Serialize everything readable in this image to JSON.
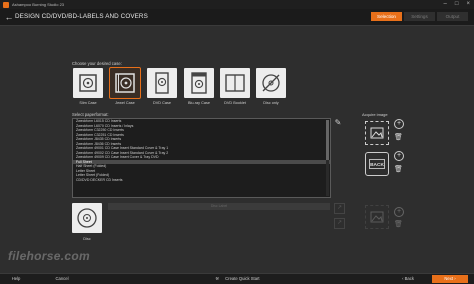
{
  "window": {
    "title": "Ashampoo Burning Studio 23"
  },
  "header": {
    "title": "DESIGN CD/DVD/BD-LABELS AND COVERS",
    "steps": [
      {
        "label": "Selection",
        "active": true
      },
      {
        "label": "Settings",
        "active": false
      },
      {
        "label": "Output",
        "active": false
      }
    ]
  },
  "cases": {
    "label": "Choose your desired case:",
    "items": [
      {
        "label": "Slim Case"
      },
      {
        "label": "Jewel Case"
      },
      {
        "label": "DVD Case"
      },
      {
        "label": "Blu-ray Case"
      },
      {
        "label": "DVD Booklet"
      },
      {
        "label": "Disc only"
      }
    ]
  },
  "paper": {
    "label": "Select paperformat:",
    "items": [
      "Zweckform L6015 CD Inserts",
      "Zweckform L6070 CD Inserts / Inlays",
      "Zweckform C32250 CD Inserts",
      "Zweckform C32251 CD Inserts",
      "Zweckform J8435 CD Inserts",
      "Zweckform J8436 CD Inserts",
      "Zweckform 49001 CD Case Insert Standard Cover & Tray 1",
      "Zweckform 49002 CD Case Insert Standard Cover & Tray 2",
      "Zweckform 49009 CD Case Insert Cover & Tray DVD",
      "Full Sheet",
      "Half Sheet (Folded)",
      "Letter Sheet",
      "Letter Sheet (Folded)",
      "CD/DVD DECKER CD Inserts"
    ],
    "selected_index": 9
  },
  "acquire": {
    "label": "Acquire image"
  },
  "disc": {
    "label": "Disc",
    "bar_text": "Disc Label"
  },
  "footer": {
    "help": "Help",
    "cancel": "Cancel",
    "create": "Create Quick Start",
    "back": "Back",
    "next": "Next"
  },
  "watermark": "filehorse.com",
  "colors": {
    "accent": "#e8701a",
    "background": "#2e2e2e"
  }
}
